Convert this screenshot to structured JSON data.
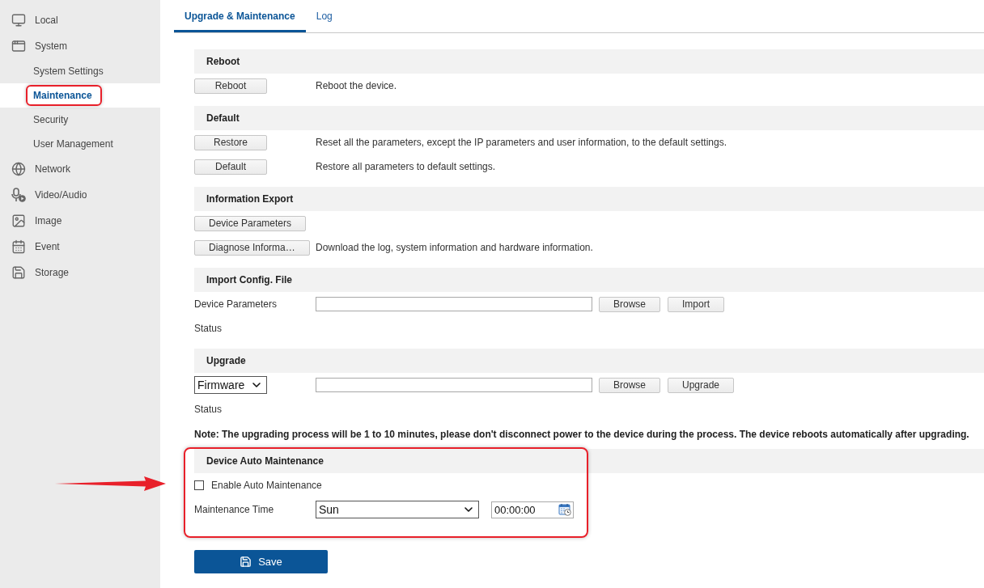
{
  "sidebar": {
    "items": [
      {
        "label": "Local",
        "selected": false,
        "highlighted": false
      },
      {
        "label": "System",
        "selected": false,
        "highlighted": false,
        "children": [
          {
            "label": "System Settings",
            "selected": false,
            "highlighted": false
          },
          {
            "label": "Maintenance",
            "selected": true,
            "highlighted": true
          },
          {
            "label": "Security",
            "selected": false,
            "highlighted": false
          },
          {
            "label": "User Management",
            "selected": false,
            "highlighted": false
          }
        ]
      },
      {
        "label": "Network",
        "selected": false,
        "highlighted": false
      },
      {
        "label": "Video/Audio",
        "selected": false,
        "highlighted": false
      },
      {
        "label": "Image",
        "selected": false,
        "highlighted": false
      },
      {
        "label": "Event",
        "selected": false,
        "highlighted": false
      },
      {
        "label": "Storage",
        "selected": false,
        "highlighted": false
      }
    ]
  },
  "tabs": [
    {
      "label": "Upgrade & Maintenance",
      "selected": true
    },
    {
      "label": "Log",
      "selected": false
    }
  ],
  "sections": [
    {
      "title": "Reboot",
      "highlighted": false,
      "pointed": false,
      "rows": [
        {
          "kind": "action",
          "button": "Reboot",
          "description": "Reboot the device."
        }
      ]
    },
    {
      "title": "Default",
      "highlighted": false,
      "pointed": false,
      "rows": [
        {
          "kind": "action",
          "button": "Restore",
          "description": "Reset all the parameters, except the IP parameters and user information, to the default settings."
        },
        {
          "kind": "action",
          "button": "Default",
          "description": "Restore all parameters to default settings."
        }
      ]
    },
    {
      "title": "Information Export",
      "highlighted": false,
      "pointed": false,
      "rows": [
        {
          "kind": "action",
          "button": "Device Parameters"
        },
        {
          "kind": "action",
          "button": "Diagnose Informa…",
          "description": "Download the log, system information and hardware information."
        }
      ]
    },
    {
      "title": "Import Config. File",
      "highlighted": false,
      "pointed": false,
      "rows": [
        {
          "kind": "file",
          "label": "Device Parameters",
          "buttons": [
            "Browse",
            "Import"
          ]
        },
        {
          "kind": "status",
          "label": "Status"
        }
      ]
    },
    {
      "title": "Upgrade",
      "highlighted": false,
      "pointed": false,
      "rows": [
        {
          "kind": "file",
          "select": "Firmware",
          "buttons": [
            "Browse",
            "Upgrade"
          ]
        },
        {
          "kind": "status",
          "label": "Status"
        },
        {
          "kind": "note",
          "text": "Note: The upgrading process will be 1 to 10 minutes, please don't disconnect power to the device during the process. The device reboots automatically after upgrading."
        }
      ]
    },
    {
      "title": "Device Auto Maintenance",
      "highlighted": true,
      "pointed": true,
      "rows": [
        {
          "kind": "checkbox",
          "label": "Enable Auto Maintenance",
          "checked": false
        },
        {
          "kind": "schedule",
          "label": "Maintenance Time",
          "day": "Sun",
          "time": "00:00:00"
        }
      ]
    }
  ],
  "save_button": {
    "label": "Save"
  }
}
